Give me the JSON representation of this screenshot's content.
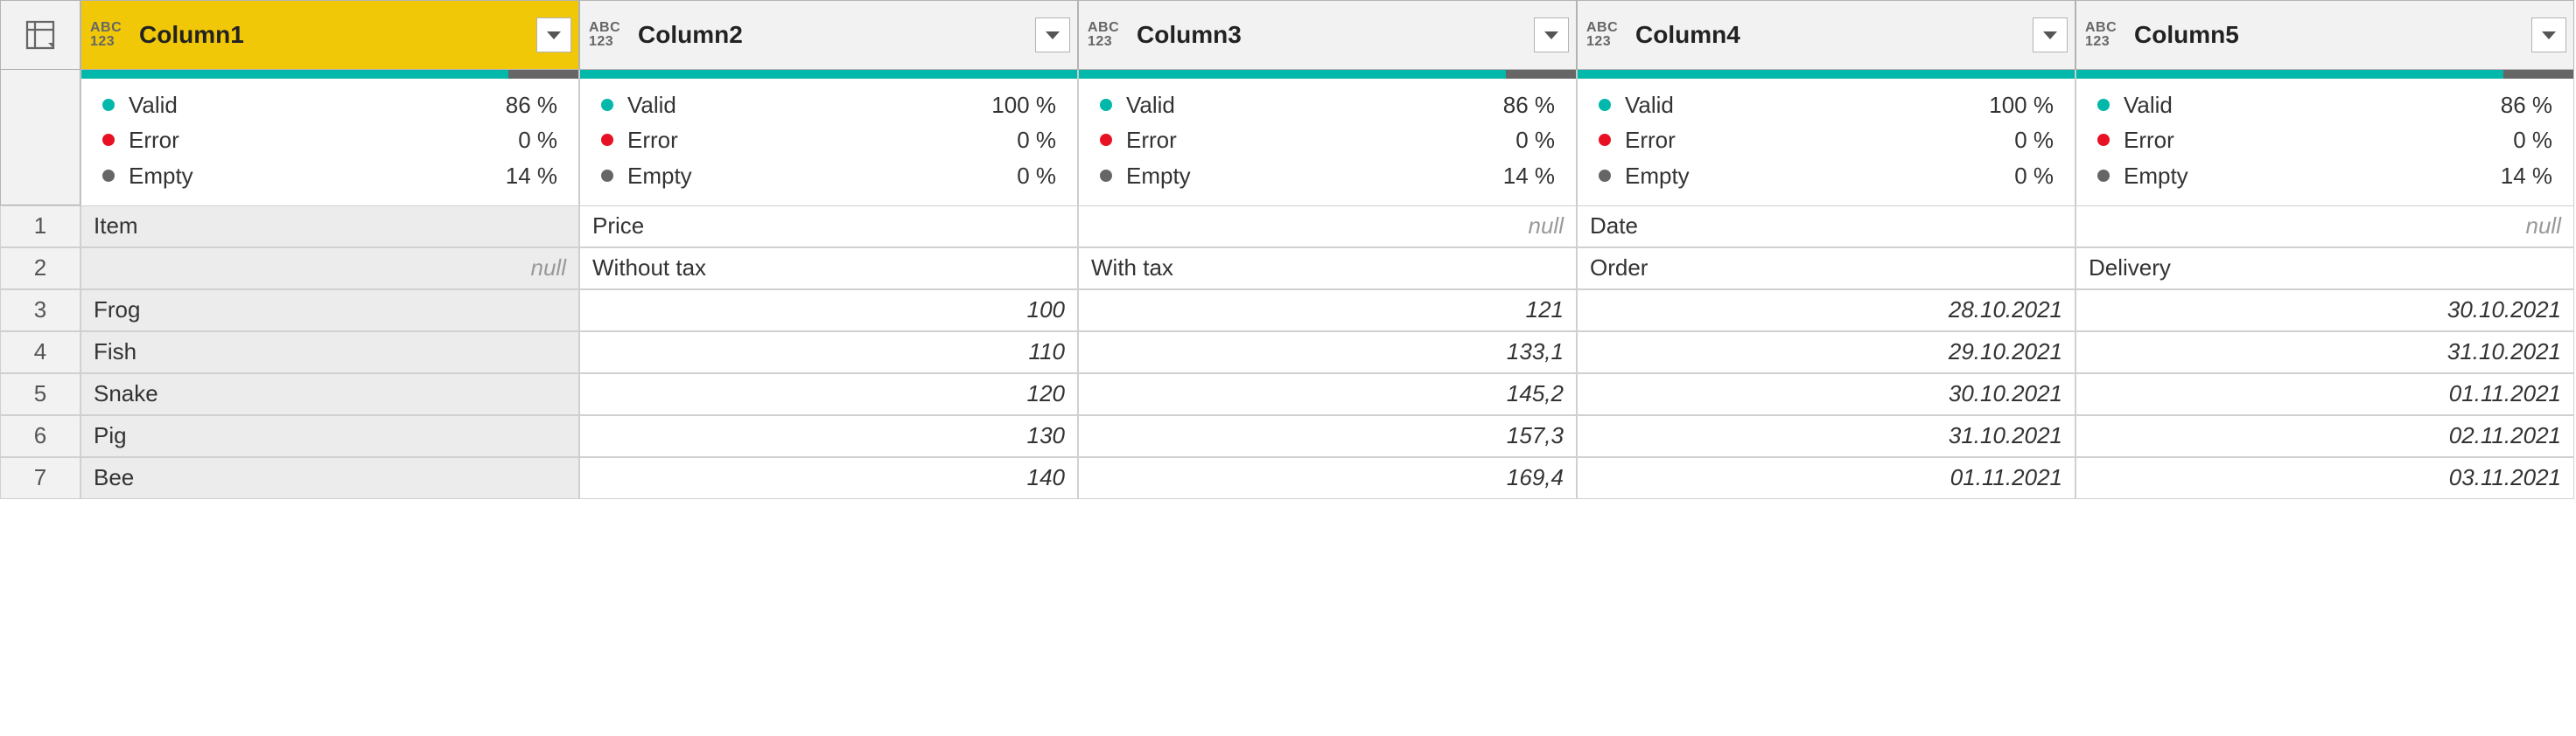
{
  "typeIcon": {
    "abc": "ABC",
    "num": "123"
  },
  "qualityLabels": {
    "valid": "Valid",
    "error": "Error",
    "empty": "Empty"
  },
  "nullText": "null",
  "columns": [
    {
      "name": "Column1",
      "selected": true,
      "quality": {
        "valid": 86,
        "error": 0,
        "empty": 14
      },
      "validTxt": "86 %",
      "errorTxt": "0 %",
      "emptyTxt": "14 %"
    },
    {
      "name": "Column2",
      "selected": false,
      "quality": {
        "valid": 100,
        "error": 0,
        "empty": 0
      },
      "validTxt": "100 %",
      "errorTxt": "0 %",
      "emptyTxt": "0 %"
    },
    {
      "name": "Column3",
      "selected": false,
      "quality": {
        "valid": 86,
        "error": 0,
        "empty": 14
      },
      "validTxt": "86 %",
      "errorTxt": "0 %",
      "emptyTxt": "14 %"
    },
    {
      "name": "Column4",
      "selected": false,
      "quality": {
        "valid": 100,
        "error": 0,
        "empty": 0
      },
      "validTxt": "100 %",
      "errorTxt": "0 %",
      "emptyTxt": "0 %"
    },
    {
      "name": "Column5",
      "selected": false,
      "quality": {
        "valid": 86,
        "error": 0,
        "empty": 14
      },
      "validTxt": "86 %",
      "errorTxt": "0 %",
      "emptyTxt": "14 %"
    }
  ],
  "rows": [
    {
      "n": "1",
      "cells": [
        {
          "v": "Item",
          "align": "l"
        },
        {
          "v": "Price",
          "align": "l"
        },
        {
          "v": null
        },
        {
          "v": "Date",
          "align": "l"
        },
        {
          "v": null
        }
      ]
    },
    {
      "n": "2",
      "cells": [
        {
          "v": null
        },
        {
          "v": "Without tax",
          "align": "l"
        },
        {
          "v": "With tax",
          "align": "l"
        },
        {
          "v": "Order",
          "align": "l"
        },
        {
          "v": "Delivery",
          "align": "l"
        }
      ]
    },
    {
      "n": "3",
      "cells": [
        {
          "v": "Frog",
          "align": "l"
        },
        {
          "v": "100",
          "align": "r",
          "i": true
        },
        {
          "v": "121",
          "align": "r",
          "i": true
        },
        {
          "v": "28.10.2021",
          "align": "r",
          "i": true
        },
        {
          "v": "30.10.2021",
          "align": "r",
          "i": true
        }
      ]
    },
    {
      "n": "4",
      "cells": [
        {
          "v": "Fish",
          "align": "l"
        },
        {
          "v": "110",
          "align": "r",
          "i": true
        },
        {
          "v": "133,1",
          "align": "r",
          "i": true
        },
        {
          "v": "29.10.2021",
          "align": "r",
          "i": true
        },
        {
          "v": "31.10.2021",
          "align": "r",
          "i": true
        }
      ]
    },
    {
      "n": "5",
      "cells": [
        {
          "v": "Snake",
          "align": "l"
        },
        {
          "v": "120",
          "align": "r",
          "i": true
        },
        {
          "v": "145,2",
          "align": "r",
          "i": true
        },
        {
          "v": "30.10.2021",
          "align": "r",
          "i": true
        },
        {
          "v": "01.11.2021",
          "align": "r",
          "i": true
        }
      ]
    },
    {
      "n": "6",
      "cells": [
        {
          "v": "Pig",
          "align": "l"
        },
        {
          "v": "130",
          "align": "r",
          "i": true
        },
        {
          "v": "157,3",
          "align": "r",
          "i": true
        },
        {
          "v": "31.10.2021",
          "align": "r",
          "i": true
        },
        {
          "v": "02.11.2021",
          "align": "r",
          "i": true
        }
      ]
    },
    {
      "n": "7",
      "cells": [
        {
          "v": "Bee",
          "align": "l"
        },
        {
          "v": "140",
          "align": "r",
          "i": true
        },
        {
          "v": "169,4",
          "align": "r",
          "i": true
        },
        {
          "v": "01.11.2021",
          "align": "r",
          "i": true
        },
        {
          "v": "03.11.2021",
          "align": "r",
          "i": true
        }
      ]
    }
  ]
}
